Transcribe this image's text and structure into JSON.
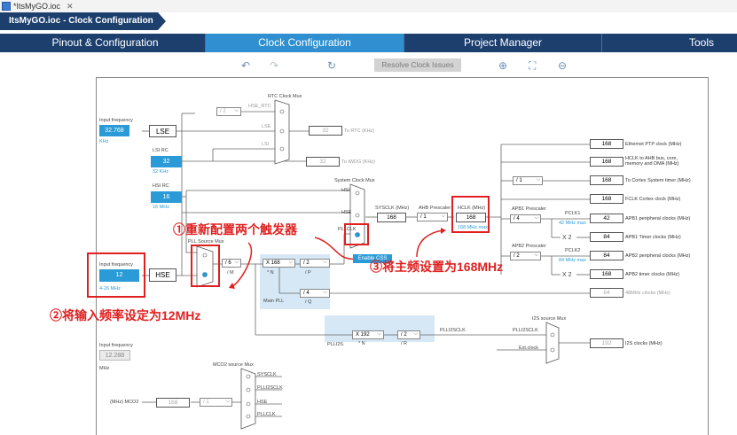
{
  "window": {
    "tab_title": "*ItsMyGO.ioc",
    "close": "✕"
  },
  "breadcrumb": "ItsMyGO.ioc - Clock Configuration",
  "tabs": [
    {
      "label": "Pinout & Configuration"
    },
    {
      "label": "Clock Configuration"
    },
    {
      "label": "Project Manager"
    },
    {
      "label": "Tools"
    }
  ],
  "toolbar": {
    "undo": "↶",
    "redo": "↷",
    "refresh": "↻",
    "resolve": "Resolve Clock Issues",
    "zoom_in": "⊕",
    "fit": "⛶",
    "zoom_out": "⊖"
  },
  "diagram": {
    "rtc_mux": "RTC Clock Mux",
    "input_freq_1": "Input frequency",
    "lse_value": "32.768",
    "khz": "KHz",
    "lse": "LSE",
    "lsi_rc": "LSI RC",
    "lsi_value": "32",
    "lsi_unit": "32 KHz",
    "hsi_rc": "HSI RC",
    "hsi_value": "16",
    "hsi_unit": "16 MHz",
    "hse_div": "/ 2",
    "hse_rtc": "HSE_RTC",
    "lse_in": "LSE",
    "lsi_in": "LSI",
    "to_rtc_value": "32",
    "to_rtc": "To RTC (KHz)",
    "to_iwdg_value": "32",
    "to_iwdg": "To IWDG (KHz)",
    "sys_mux": "System Clock Mux",
    "hsi": "HSI",
    "hse_in": "HSE",
    "pllclk": "PLLCLK",
    "sysclk_label": "SYSCLK (MHz)",
    "sysclk_value": "168",
    "ahb_label": "AHB Prescaler",
    "ahb_value": "/ 1",
    "hclk_label": "HCLK (MHz)",
    "hclk_value": "168",
    "hclk_max": "168 MHz max",
    "enable_css": "Enable CSS",
    "input_freq_2": "Input frequency",
    "hse_value": "12",
    "hse_range": "4-26 MHz",
    "hse": "HSE",
    "pll_source_mux": "PLL Source Mux",
    "m_div": "/ 6",
    "m": "/ M",
    "n_mul": "X 168",
    "n": "* N",
    "p_div": "/ 2",
    "p": "/ P",
    "q_div": "/ 4",
    "q": "/ Q",
    "main_pll": "Main PLL",
    "apb1_label": "APB1 Prescaler",
    "apb1_value": "/ 4",
    "pclk1": "PCLK1",
    "pclk1_max": "42 MHz max",
    "x2_1": "X 2",
    "apb2_label": "APB2 Prescaler",
    "apb2_value": "/ 2",
    "pclk2": "PCLK2",
    "pclk2_max": "84 MHz max",
    "x2_2": "X 2",
    "cortex_div": "/ 1",
    "plli2s_n": "X 192",
    "plli2s_n_lbl": "* N",
    "plli2s_r": "/ 2",
    "plli2s_r_lbl": "/ R",
    "plli2s": "PLLI2S",
    "plli2sclk": "PLLI2SCLK",
    "plli2sclk_in": "PLLI2SCLK",
    "ext_clock": "Ext.clock",
    "i2s_mux": "I2S source Mux",
    "i2s_value": "192",
    "i2s_out": "I2S clocks (MHz)",
    "input_freq_3": "Input frequency",
    "ext_value": "12.288",
    "mhz": "MHz",
    "mco2_mux": "MCO2 source Mux",
    "mco2_sysclk": "SYSCLK",
    "mco2_plli2s": "PLLI2SCLK",
    "mco2_hse": "HSE",
    "mco2_pll": "PLLCLK",
    "mco2_label": "(MHz) MCO2",
    "mco2_value": "168",
    "mco2_div": "/ 1"
  },
  "outputs": [
    {
      "value": "168",
      "label": "Ethernet PTP clock (MHz)"
    },
    {
      "value": "168",
      "label": "HCLK to AHB bus, core, memory and DMA (MHz)"
    },
    {
      "value": "168",
      "label": "To Cortex System timer (MHz)"
    },
    {
      "value": "168",
      "label": "FCLK Cortex clock (MHz)"
    },
    {
      "value": "42",
      "label": "APB1 peripheral clocks (MHz)"
    },
    {
      "value": "84",
      "label": "APB1 Timer clocks (MHz)"
    },
    {
      "value": "84",
      "label": "APB2 peripheral clocks (MHz)"
    },
    {
      "value": "168",
      "label": "APB2 timer clocks (MHz)"
    },
    {
      "value": "84",
      "label": "48MHz clocks (MHz)"
    }
  ],
  "annotations": {
    "a1": "①重新配置两个触发器",
    "a2": "②将输入频率设定为12MHz",
    "a3": "③将主频设置为168MHz"
  },
  "colors": {
    "nav": "#1c3f6e",
    "active_tab": "#2f8fd0",
    "field": "#2b9bd8",
    "annotation": "#e02020"
  }
}
